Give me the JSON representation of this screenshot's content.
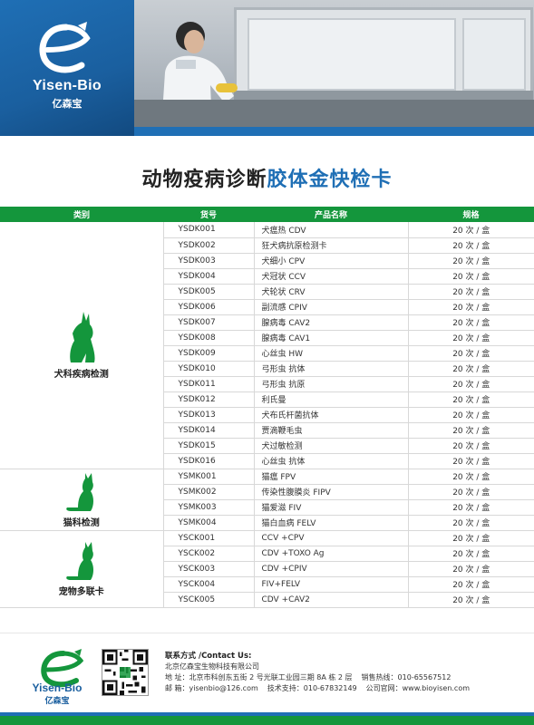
{
  "brand": {
    "name_en": "Yisen-Bio",
    "name_cn": "亿森宝",
    "colors": {
      "blue": "#1f6fb5",
      "green": "#14963c"
    }
  },
  "title": {
    "part1": "动物疫病诊断",
    "part2": "胶体金快检卡"
  },
  "table": {
    "headers": {
      "category": "类别",
      "code": "货号",
      "name": "产品名称",
      "spec": "规格"
    },
    "groups": [
      {
        "label": "犬科疾病检测",
        "icon": "dog-icon",
        "rows": [
          {
            "code": "YSDK001",
            "name": "犬瘟热 CDV",
            "spec": "20 次 / 盒"
          },
          {
            "code": "YSDK002",
            "name": "狂犬病抗原检测卡",
            "spec": "20 次 / 盒"
          },
          {
            "code": "YSDK003",
            "name": "犬细小 CPV",
            "spec": "20 次 / 盒"
          },
          {
            "code": "YSDK004",
            "name": "犬冠状 CCV",
            "spec": "20 次 / 盒"
          },
          {
            "code": "YSDK005",
            "name": "犬轮状 CRV",
            "spec": "20 次 / 盒"
          },
          {
            "code": "YSDK006",
            "name": "副流感 CPIV",
            "spec": "20 次 / 盒"
          },
          {
            "code": "YSDK007",
            "name": "腺病毒 CAV2",
            "spec": "20 次 / 盒"
          },
          {
            "code": "YSDK008",
            "name": "腺病毒 CAV1",
            "spec": "20 次 / 盒"
          },
          {
            "code": "YSDK009",
            "name": "心丝虫 HW",
            "spec": "20 次 / 盒"
          },
          {
            "code": "YSDK010",
            "name": "弓形虫 抗体",
            "spec": "20 次 / 盒"
          },
          {
            "code": "YSDK011",
            "name": "弓形虫 抗原",
            "spec": "20 次 / 盒"
          },
          {
            "code": "YSDK012",
            "name": "利氏曼",
            "spec": "20 次 / 盒"
          },
          {
            "code": "YSDK013",
            "name": "犬布氏杆菌抗体",
            "spec": "20 次 / 盒"
          },
          {
            "code": "YSDK014",
            "name": "贾滴鞭毛虫",
            "spec": "20 次 / 盒"
          },
          {
            "code": "YSDK015",
            "name": "犬过敏检测",
            "spec": "20 次 / 盒"
          },
          {
            "code": "YSDK016",
            "name": "心丝虫 抗体",
            "spec": "20 次 / 盒"
          }
        ]
      },
      {
        "label": "猫科检测",
        "icon": "cat-icon",
        "rows": [
          {
            "code": "YSMK001",
            "name": "猫瘟  FPV",
            "spec": "20 次 / 盒"
          },
          {
            "code": "YSMK002",
            "name": "传染性腹膜炎 FIPV",
            "spec": "20 次 / 盒"
          },
          {
            "code": "YSMK003",
            "name": "猫爱滋 FIV",
            "spec": "20 次 / 盒"
          },
          {
            "code": "YSMK004",
            "name": "猫白血病 FELV",
            "spec": "20 次 / 盒"
          }
        ]
      },
      {
        "label": "宠物多联卡",
        "icon": "cat-icon",
        "rows": [
          {
            "code": "YSCK001",
            "name": "CCV +CPV",
            "spec": "20 次 / 盒"
          },
          {
            "code": "YSCK002",
            "name": "CDV +TOXO Ag",
            "spec": "20 次 / 盒"
          },
          {
            "code": "YSCK003",
            "name": "CDV +CPIV",
            "spec": "20 次 / 盒"
          },
          {
            "code": "YSCK004",
            "name": "FIV+FELV",
            "spec": "20 次 / 盒"
          },
          {
            "code": "YSCK005",
            "name": "CDV +CAV2",
            "spec": "20 次 / 盒"
          }
        ]
      }
    ]
  },
  "contact": {
    "title": "联系方式 /Contact Us:",
    "company": "北京亿森宝生物科技有限公司",
    "address_label": "地    址：",
    "address": "北京市科创东五街 2 号光联工业园三期 8A 栋 2 层",
    "sales_label": "销售热线：",
    "sales": "010-65567512",
    "email_label": "邮    箱：",
    "email": "yisenbio@126.com",
    "support_label": "技术支持：",
    "support": "010-67832149",
    "website_label": "公司官网：",
    "website": "www.bioyisen.com"
  }
}
